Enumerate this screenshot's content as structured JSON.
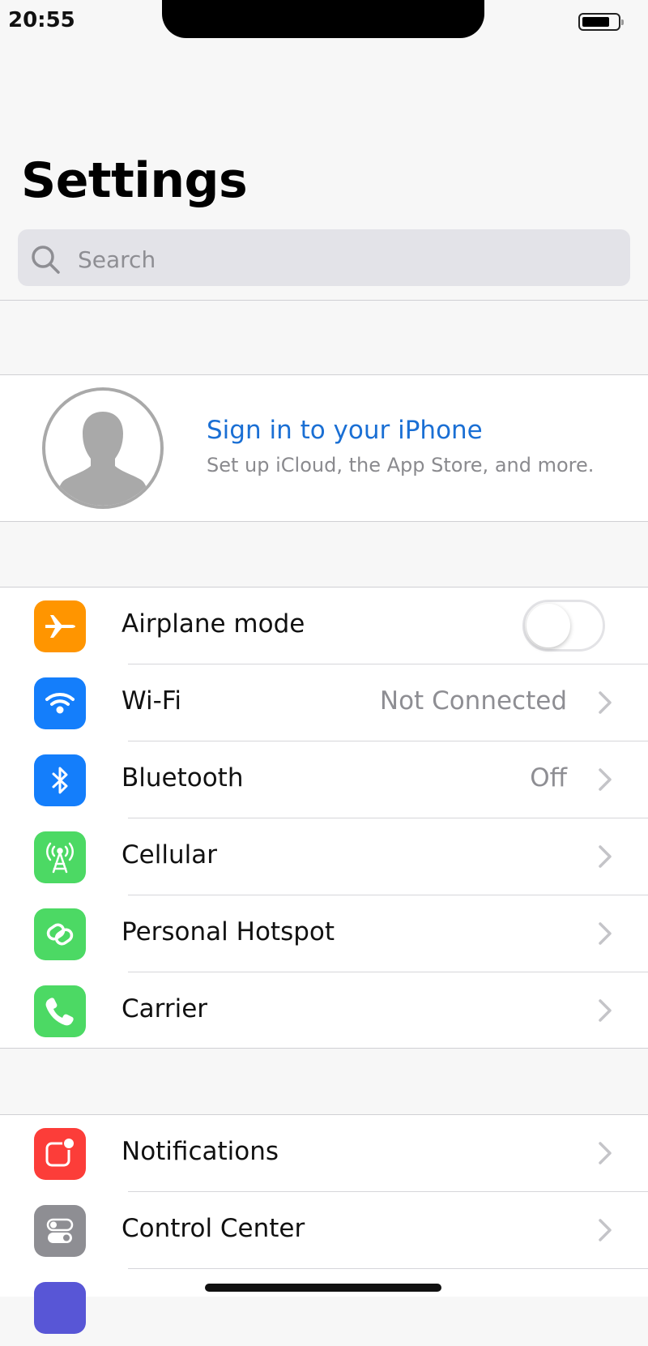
{
  "status_bar": {
    "time": "20:55"
  },
  "page_title": "Settings",
  "search": {
    "placeholder": "Search"
  },
  "profile": {
    "title": "Sign in to your iPhone",
    "subtitle": "Set up iCloud, the App Store, and more."
  },
  "connectivity": [
    {
      "label": "Airplane mode",
      "icon": "airplane-icon",
      "color": "#ff9500",
      "toggle_on": false
    },
    {
      "label": "Wi-Fi",
      "value": "Not Connected",
      "icon": "wifi-icon",
      "color": "#147efb"
    },
    {
      "label": "Bluetooth",
      "value": "Off",
      "icon": "bluetooth-icon",
      "color": "#147efb"
    },
    {
      "label": "Cellular",
      "icon": "cellular-antenna-icon",
      "color": "#4cd964"
    },
    {
      "label": "Personal Hotspot",
      "icon": "hotspot-icon",
      "color": "#4cd964"
    },
    {
      "label": "Carrier",
      "icon": "phone-icon",
      "color": "#4cd964"
    }
  ],
  "system": [
    {
      "label": "Notifications",
      "icon": "notifications-icon",
      "color": "#fc3d39"
    },
    {
      "label": "Control Center",
      "icon": "control-center-icon",
      "color": "#8e8e93"
    }
  ]
}
